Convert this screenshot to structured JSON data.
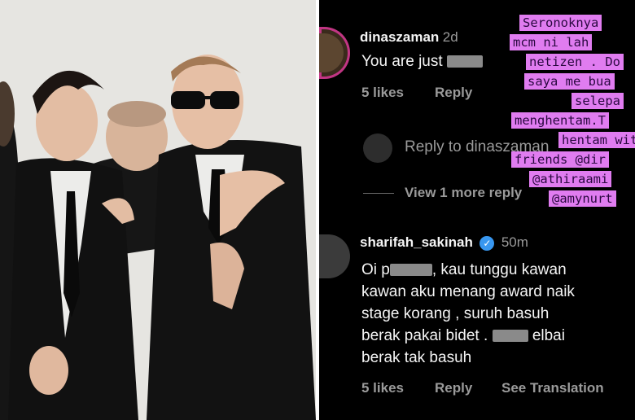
{
  "comments": [
    {
      "username": "dinaszaman",
      "time": "2d",
      "text": "You are just",
      "likes": "5 likes",
      "reply": "Reply"
    },
    {
      "username": "sharifah_sakinah",
      "time": "50m",
      "lines": [
        "Oi p",
        ", kau tunggu kawan",
        "kawan aku menang award naik",
        "stage  korang , suruh basuh",
        "berak pakai bidet .",
        "elbai",
        "berak tak basuh"
      ],
      "likes": "5 likes",
      "reply": "Reply",
      "translation": "See Translation"
    }
  ],
  "reply_box": {
    "label": "Reply to dinaszaman"
  },
  "view_more": "View 1 more reply",
  "highlight_overlay": {
    "lines": [
      "Seronoknya",
      "mcm ni lah",
      "netizen . Do",
      "saya me bua",
      "selepa",
      "menghentam.T",
      "hentam wit",
      "friends @dir",
      "@athiraami",
      "@amynurt"
    ]
  },
  "colors": {
    "highlight": "#e07cf0",
    "verified": "#3897f0",
    "muted": "#9a9a9a"
  }
}
